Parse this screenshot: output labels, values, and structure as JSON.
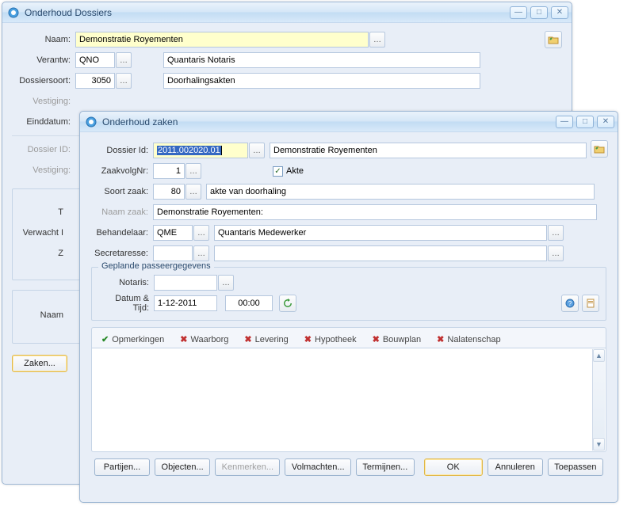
{
  "back_window": {
    "title": "Onderhoud Dossiers",
    "naam_label": "Naam:",
    "naam_value": "Demonstratie Royementen",
    "verantw_label": "Verantw:",
    "verantw_code": "QNO",
    "verantw_name": "Quantaris Notaris",
    "dossiersoort_label": "Dossiersoort:",
    "dossiersoort_code": "3050",
    "dossiersoort_name": "Doorhalingsakten",
    "vestiging_label": "Vestiging:",
    "einddatum_label": "Einddatum:",
    "dossierid_label": "Dossier ID:",
    "vestiging2_label": "Vestiging:",
    "verwacht_label": "Verwacht I",
    "t_label": "T",
    "z_label": "Z",
    "naam2_label": "Naam",
    "zaken_btn": "Zaken..."
  },
  "front_window": {
    "title": "Onderhoud zaken",
    "dossierid_label": "Dossier Id:",
    "dossierid_value": "2011.002020.01",
    "dossier_name": "Demonstratie Royementen",
    "zaakvolgnr_label": "ZaakvolgNr:",
    "zaakvolgnr_value": "1",
    "akte_label": "Akte",
    "soortzaak_label": "Soort zaak:",
    "soortzaak_code": "80",
    "soortzaak_name": "akte van doorhaling",
    "naamzaak_label": "Naam zaak:",
    "naamzaak_value": "Demonstratie Royementen:",
    "behandelaar_label": "Behandelaar:",
    "behandelaar_code": "QME",
    "behandelaar_name": "Quantaris Medewerker",
    "secretaresse_label": "Secretaresse:",
    "group_title": "Geplande passeergegevens",
    "notaris_label": "Notaris:",
    "datumtijd_label": "Datum & Tijd:",
    "datum_value": "1-12-2011",
    "tijd_value": "00:00",
    "tabs": [
      {
        "label": "Opmerkingen",
        "ok": true
      },
      {
        "label": "Waarborg",
        "ok": false
      },
      {
        "label": "Levering",
        "ok": false
      },
      {
        "label": "Hypotheek",
        "ok": false
      },
      {
        "label": "Bouwplan",
        "ok": false
      },
      {
        "label": "Nalatenschap",
        "ok": false
      }
    ],
    "buttons": {
      "partijen": "Partijen...",
      "objecten": "Objecten...",
      "kenmerken": "Kenmerken...",
      "volmachten": "Volmachten...",
      "termijnen": "Termijnen...",
      "ok": "OK",
      "annuleren": "Annuleren",
      "toepassen": "Toepassen"
    }
  }
}
